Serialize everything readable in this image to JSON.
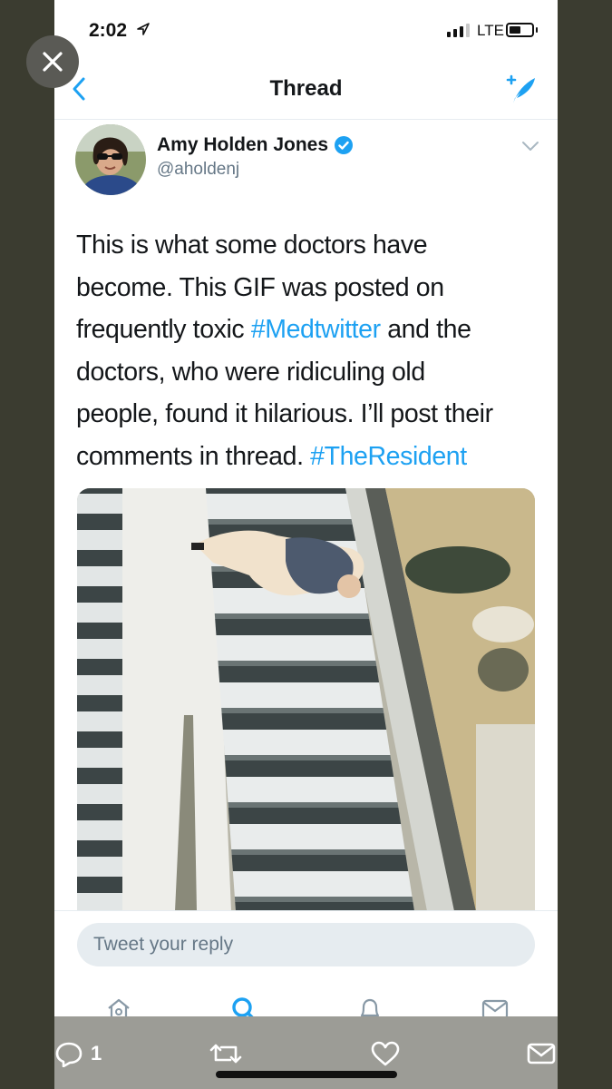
{
  "status_bar": {
    "time": "2:02",
    "network": "LTE"
  },
  "nav": {
    "title": "Thread",
    "back_icon": "chevron-left-icon",
    "compose_icon": "compose-tweet-icon"
  },
  "tweet": {
    "author_name": "Amy Holden Jones",
    "handle": "@aholdenj",
    "verified": true,
    "text_lines": [
      [
        "This is what some doctors have",
        null
      ],
      [
        "become.  This GIF was posted on",
        null
      ],
      [
        "frequently toxic ",
        "#Medtwitter",
        " and the"
      ],
      [
        "doctors, who were ridiculing old",
        null
      ],
      [
        "people, found it hilarious. I’ll post their",
        null
      ],
      [
        "comments in thread. ",
        "#TheResident"
      ]
    ]
  },
  "reply": {
    "placeholder": "Tweet your reply"
  },
  "tabs": [
    "home-icon",
    "search-icon",
    "notifications-icon",
    "messages-icon"
  ],
  "overlay": {
    "reply_count": "1",
    "icons": [
      "reply-icon",
      "retweet-icon",
      "like-icon",
      "share-icon"
    ]
  },
  "colors": {
    "accent": "#1da1f2",
    "text": "#14171a",
    "secondary": "#657786",
    "background_outer": "#3b3c30"
  }
}
